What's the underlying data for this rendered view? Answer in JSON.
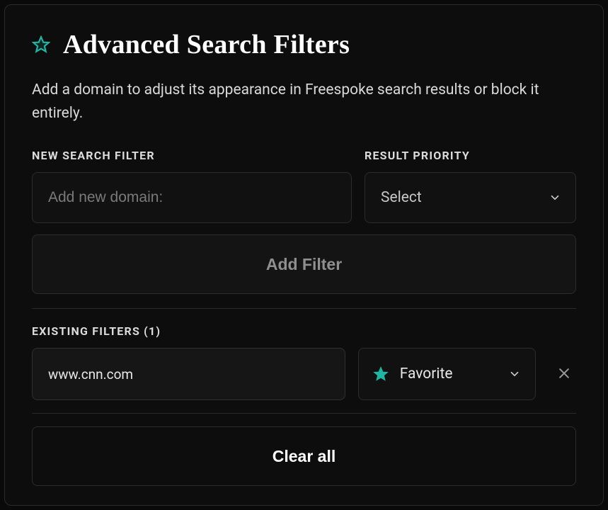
{
  "header": {
    "title": "Advanced Search Filters",
    "subtitle": "Add a domain to adjust its appearance in Freespoke search results or block it entirely."
  },
  "newFilter": {
    "domainLabel": "NEW SEARCH FILTER",
    "priorityLabel": "RESULT PRIORITY",
    "domainPlaceholder": "Add new domain:",
    "domainValue": "",
    "prioritySelected": "Select",
    "addButton": "Add Filter"
  },
  "existing": {
    "label": "EXISTING FILTERS (1)",
    "count": 1,
    "items": [
      {
        "domain": "www.cnn.com",
        "priority": "Favorite"
      }
    ]
  },
  "actions": {
    "clearAll": "Clear all"
  },
  "colors": {
    "accent": "#1fb6a4",
    "bg": "#0d0d0d",
    "border": "#2c2c2c",
    "textMuted": "#8f8f8f"
  }
}
